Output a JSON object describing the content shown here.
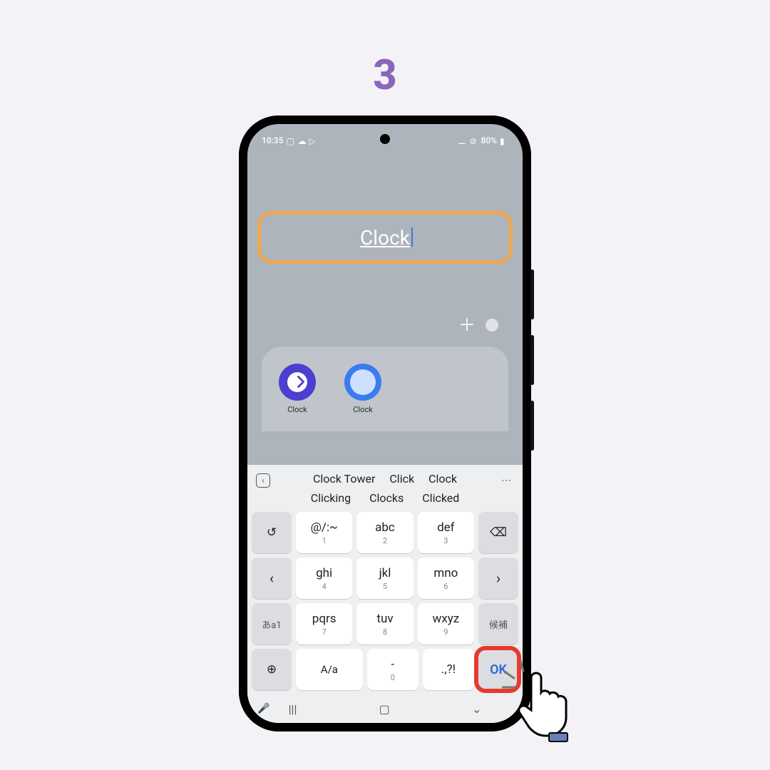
{
  "step": "3",
  "status": {
    "time": "10:35",
    "battery": "80%"
  },
  "folder": {
    "name": "Clock",
    "apps": [
      {
        "label": "Clock"
      },
      {
        "label": "Clock"
      }
    ]
  },
  "suggestions": {
    "row1": [
      "Clock Tower",
      "Click",
      "Clock"
    ],
    "row2": [
      "Clicking",
      "Clocks",
      "Clicked"
    ]
  },
  "keys": {
    "r1": [
      {
        "main": "@/:~",
        "sub": "1"
      },
      {
        "main": "abc",
        "sub": "2"
      },
      {
        "main": "def",
        "sub": "3"
      }
    ],
    "r2": [
      {
        "main": "ghi",
        "sub": "4"
      },
      {
        "main": "jkl",
        "sub": "5"
      },
      {
        "main": "mno",
        "sub": "6"
      }
    ],
    "r3": [
      {
        "main": "pqrs",
        "sub": "7"
      },
      {
        "main": "tuv",
        "sub": "8"
      },
      {
        "main": "wxyz",
        "sub": "9"
      }
    ],
    "r4": [
      {
        "main": "A/a"
      },
      {
        "main": "-",
        "sub": "0"
      },
      {
        "main": ".,?!"
      }
    ],
    "side": {
      "undo": "↺",
      "left": "‹",
      "mode": "あa1",
      "globe": "⊕",
      "bksp": "⌫",
      "right": "›",
      "cand": "候補",
      "ok": "OK"
    }
  }
}
